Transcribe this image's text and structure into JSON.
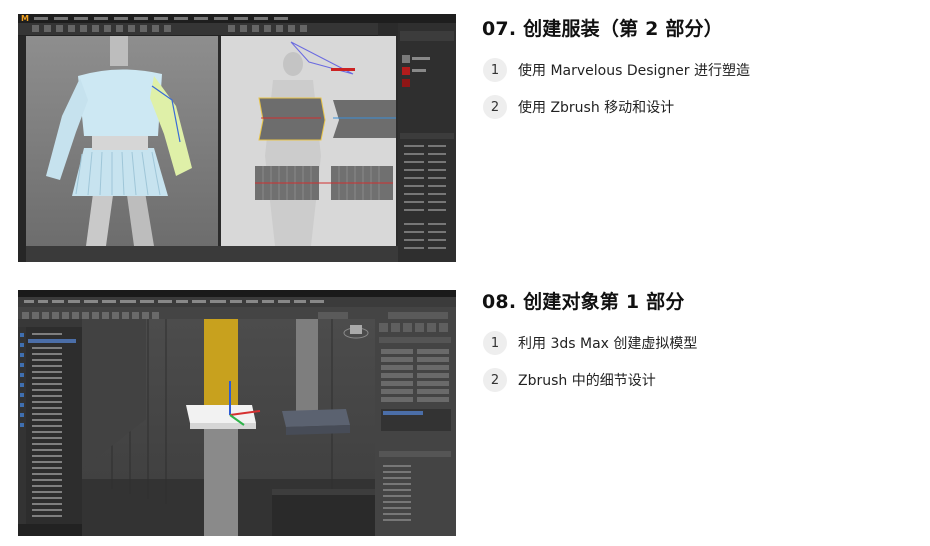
{
  "sections": [
    {
      "title": "07. 创建服装（第 2 部分）",
      "items": [
        {
          "num": "1",
          "text": "使用 Marvelous Designer 进行塑造"
        },
        {
          "num": "2",
          "text": "使用 Zbrush 移动和设计"
        }
      ]
    },
    {
      "title": "08. 创建对象第 1 部分",
      "items": [
        {
          "num": "1",
          "text": "利用 3ds Max 创建虚拟模型"
        },
        {
          "num": "2",
          "text": "Zbrush 中的细节设计"
        }
      ]
    }
  ],
  "screenshots": {
    "shot1": {
      "app_logo": "M"
    }
  },
  "colors": {
    "badge_bg": "#eeeeee",
    "title_text": "#111111",
    "body_text": "#222222",
    "md_logo": "#f0a020",
    "max_yellow_column": "#c8a11e"
  }
}
